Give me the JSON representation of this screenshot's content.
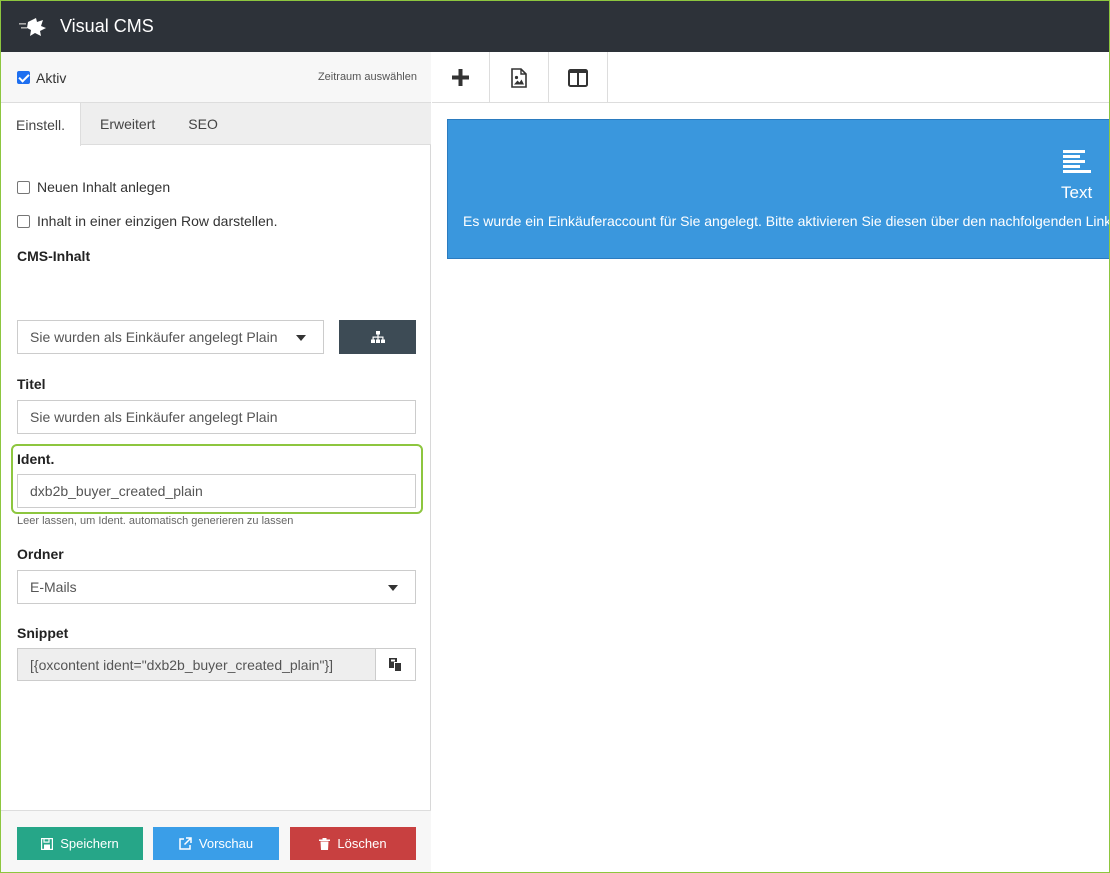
{
  "header": {
    "title": "Visual CMS"
  },
  "status": {
    "active_label": "Aktiv",
    "active_checked": true,
    "period_link": "Zeitraum auswählen"
  },
  "tabs": [
    {
      "label": "Einstell.",
      "active": true
    },
    {
      "label": "Erweitert",
      "active": false
    },
    {
      "label": "SEO",
      "active": false
    }
  ],
  "form": {
    "new_content_label": "Neuen Inhalt anlegen",
    "single_row_label": "Inhalt in einer einzigen Row darstellen.",
    "cms_content_label": "CMS-Inhalt",
    "cms_content_value": "Sie wurden als Einkäufer angelegt Plain",
    "title_label": "Titel",
    "title_value": "Sie wurden als Einkäufer angelegt Plain",
    "ident_label": "Ident.",
    "ident_value": "dxb2b_buyer_created_plain",
    "ident_help": "Leer lassen, um Ident. automatisch generieren zu lassen",
    "folder_label": "Ordner",
    "folder_value": "E-Mails",
    "snippet_label": "Snippet",
    "snippet_value": "[{oxcontent ident=\"dxb2b_buyer_created_plain\"}]"
  },
  "footer": {
    "save_label": "Speichern",
    "preview_label": "Vorschau",
    "delete_label": "Löschen"
  },
  "toolbar": {
    "icons": [
      "plus-icon",
      "image-file-icon",
      "columns-icon"
    ]
  },
  "content_block": {
    "type_label": "Text",
    "preview_text": "Es wurde ein Einkäuferaccount für Sie angelegt. Bitte aktivieren Sie diesen über den nachfolgenden Link."
  },
  "colors": {
    "accent_green": "#8dc63f",
    "block_blue": "#3a97dd",
    "save": "#26a688",
    "preview": "#3a9ee8",
    "delete": "#c84040"
  }
}
